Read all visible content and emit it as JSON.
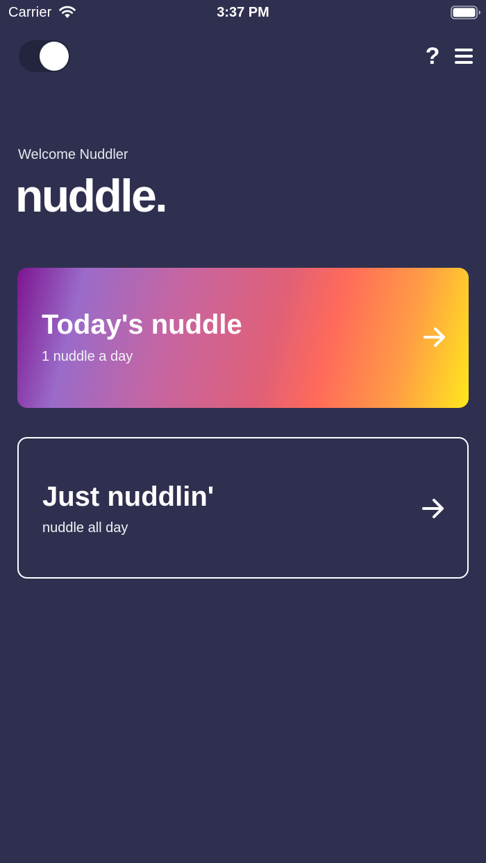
{
  "status_bar": {
    "carrier": "Carrier",
    "time": "3:37 PM"
  },
  "header": {
    "toggle_state": "on",
    "help_label": "?"
  },
  "hero": {
    "welcome": "Welcome Nuddler",
    "logo": "nuddle."
  },
  "cards": [
    {
      "title": "Today's nuddle",
      "subtitle": "1 nuddle a day",
      "icon": "arrow-right-icon"
    },
    {
      "title": "Just nuddlin'",
      "subtitle": "nuddle all day",
      "icon": "arrow-right-icon"
    }
  ],
  "colors": {
    "background": "#2f3050",
    "gradient_start": "#7d1590",
    "gradient_mid": "#ff6a5a",
    "gradient_end": "#ffe81c"
  }
}
